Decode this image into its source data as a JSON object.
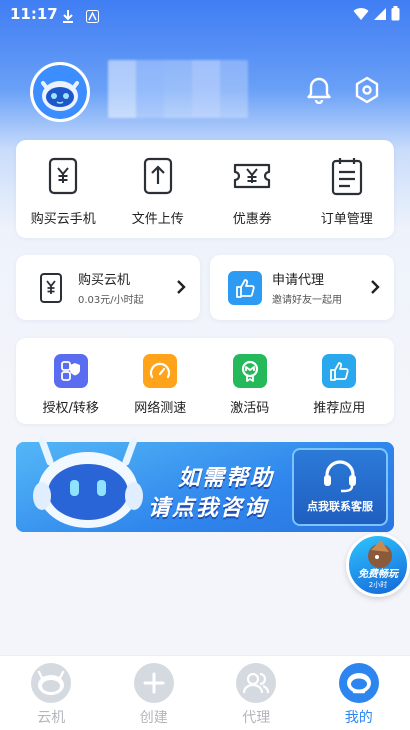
{
  "status_bar": {
    "time": "11:17"
  },
  "profile": {
    "avatar_icon": "robot-mascot-icon"
  },
  "quick_actions": [
    {
      "label": "购买云手机",
      "icon": "phone-yen-icon"
    },
    {
      "label": "文件上传",
      "icon": "upload-icon"
    },
    {
      "label": "优惠券",
      "icon": "coupon-icon"
    },
    {
      "label": "订单管理",
      "icon": "order-list-icon"
    }
  ],
  "promos": {
    "buy": {
      "title": "购买云机",
      "subtitle": "0.03元/小时起"
    },
    "agent": {
      "title": "申请代理",
      "subtitle": "邀请好友一起用"
    }
  },
  "tools": [
    {
      "label": "授权/转移",
      "color": "#5a6cf0"
    },
    {
      "label": "网络测速",
      "color": "#ffa31a"
    },
    {
      "label": "激活码",
      "color": "#26b95c"
    },
    {
      "label": "推荐应用",
      "color": "#29a8ee"
    }
  ],
  "banner": {
    "line1": "如需帮助",
    "line2": "请点我咨询",
    "button": "点我联系客服"
  },
  "float_badge": {
    "line1": "免费畅玩",
    "line2": "2小时"
  },
  "tabbar": [
    {
      "label": "云机",
      "active": false
    },
    {
      "label": "创建",
      "active": false
    },
    {
      "label": "代理",
      "active": false
    },
    {
      "label": "我的",
      "active": true
    }
  ],
  "colors": {
    "accent": "#2d86f0",
    "header_top": "#3f7df3"
  }
}
